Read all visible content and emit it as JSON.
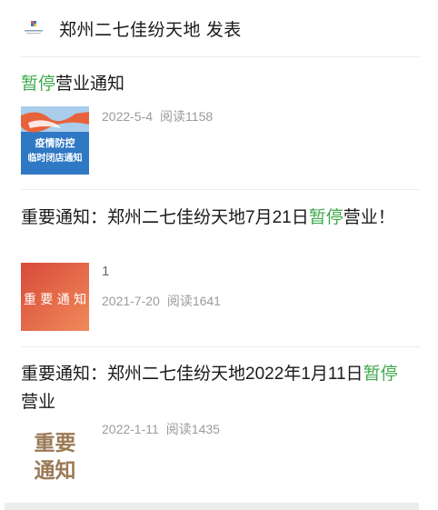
{
  "header": {
    "title": "郑州二七佳纷天地 发表",
    "logo": "mall-logo"
  },
  "articles": [
    {
      "title_parts": [
        {
          "text": "暂停",
          "highlight": true
        },
        {
          "text": "营业通知",
          "highlight": false
        }
      ],
      "thumb_text_1": "疫情防控",
      "thumb_text_2": "临时闭店通知",
      "date": "2022-5-4",
      "reads": "阅读1158"
    },
    {
      "title_parts": [
        {
          "text": "重要通知：郑州二七佳纷天地7月21日",
          "highlight": false
        },
        {
          "text": "暂停",
          "highlight": true
        },
        {
          "text": "营业！",
          "highlight": false
        }
      ],
      "thumb_text_1": "重 要 通 知",
      "extra": "1",
      "date": "2021-7-20",
      "reads": "阅读1641"
    },
    {
      "title_parts": [
        {
          "text": "重要通知：郑州二七佳纷天地2022年1月11日",
          "highlight": false
        },
        {
          "text": "暂停",
          "highlight": true
        },
        {
          "text": "营业",
          "highlight": false
        }
      ],
      "thumb_text_1": "重要",
      "thumb_text_2": "通知",
      "date": "2022-1-11",
      "reads": "阅读1435"
    }
  ],
  "colors": {
    "highlight": "#3fa94b",
    "meta": "#9b9b9b"
  }
}
